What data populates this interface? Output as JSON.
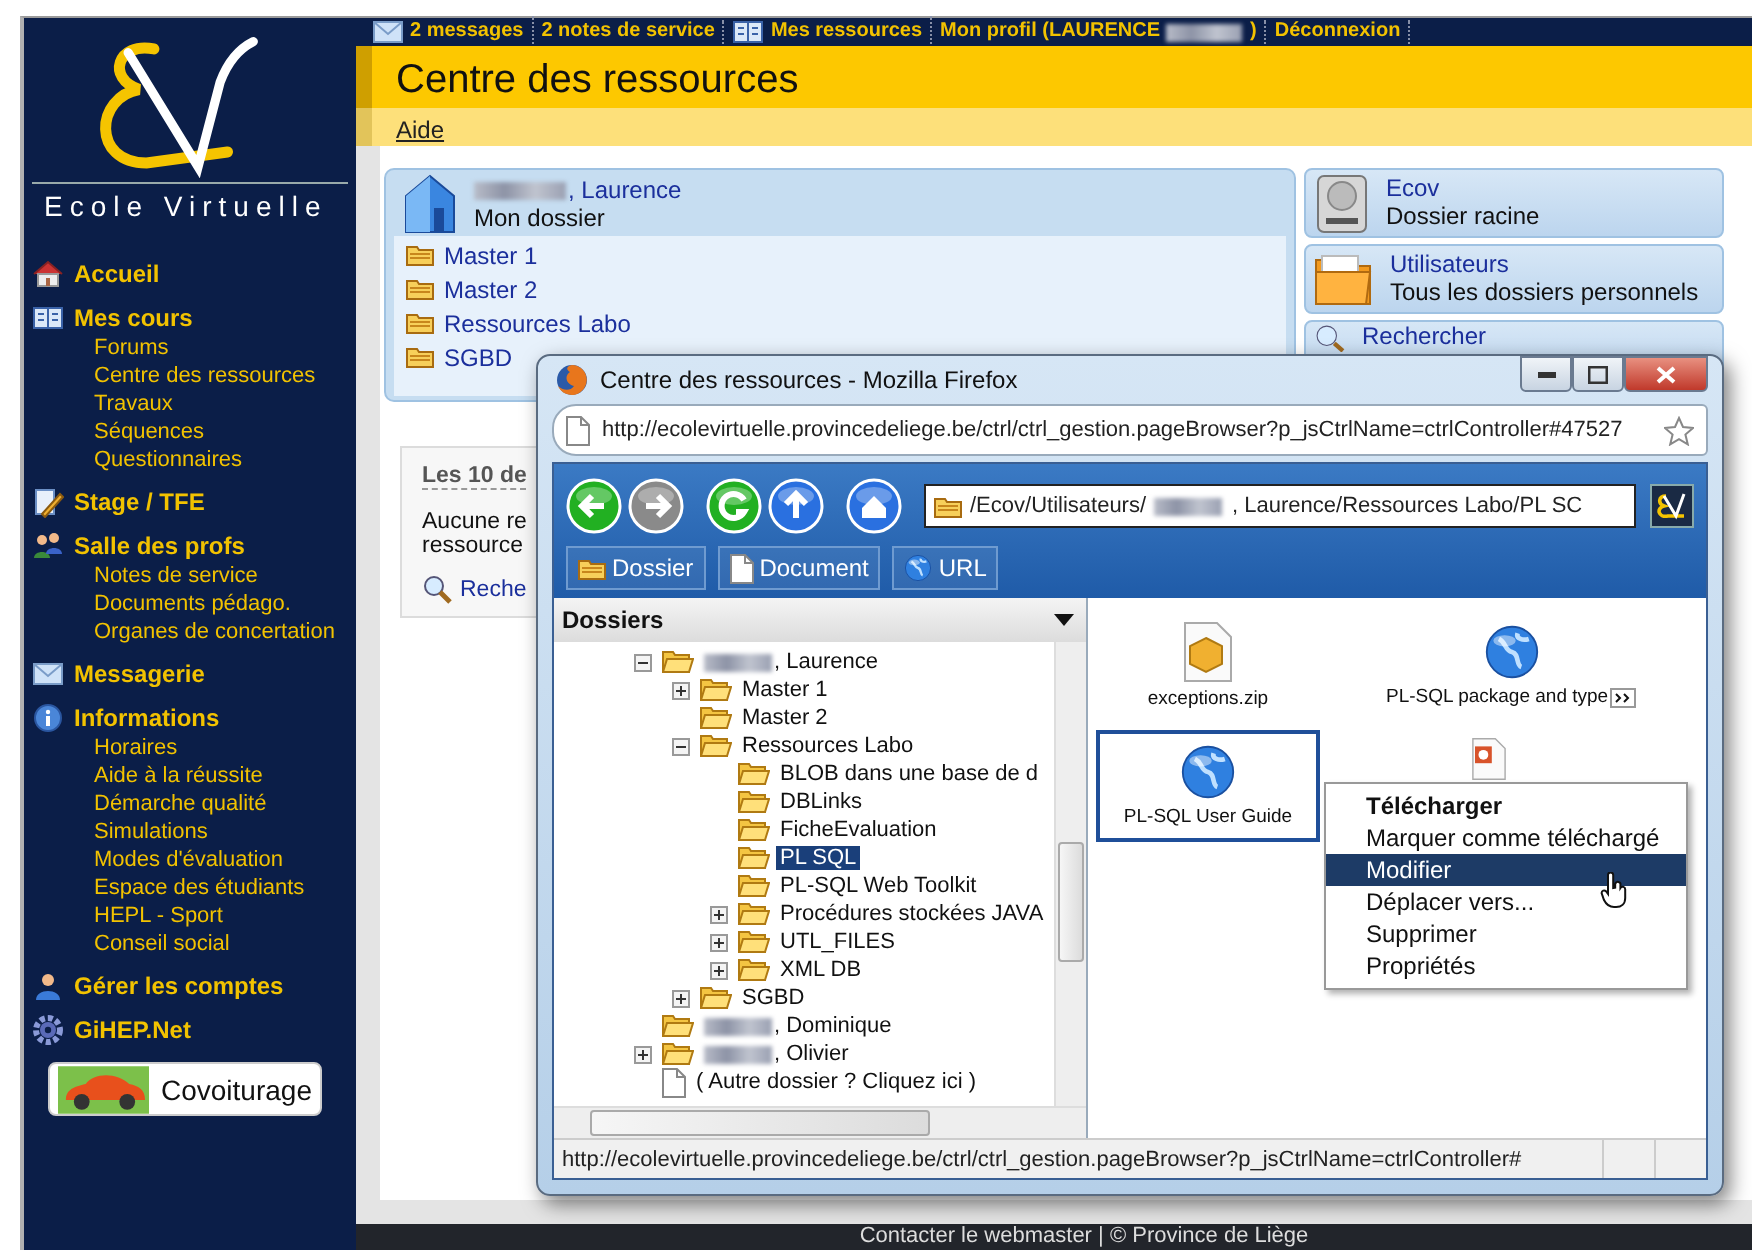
{
  "top_bar": {
    "links": [
      {
        "kind": "mail",
        "label": "2 messages"
      },
      {
        "label": "2 notes de service"
      },
      {
        "kind": "book",
        "label": "Mes ressources"
      },
      {
        "label": "Mon profil (LAURENCE",
        "redacted": true,
        "suffix": ")"
      },
      {
        "label": "Déconnexion"
      }
    ]
  },
  "sidebar": {
    "logo_text": "Ecole Virtuelle",
    "sections": [
      {
        "kind": "home",
        "label": "Accueil"
      },
      {
        "kind": "book",
        "label": "Mes cours",
        "items": [
          "Forums",
          "Centre des ressources",
          "Travaux",
          "Séquences",
          "Questionnaires"
        ]
      },
      {
        "kind": "pencil",
        "label": "Stage / TFE"
      },
      {
        "kind": "people",
        "label": "Salle des profs",
        "items": [
          "Notes de service",
          "Documents pédago.",
          "Organes de concertation"
        ]
      },
      {
        "kind": "mail",
        "label": "Messagerie"
      },
      {
        "kind": "info",
        "label": "Informations",
        "items": [
          "Horaires",
          "Aide à la réussite",
          "Démarche qualité",
          "Simulations",
          "Modes d'évaluation",
          "Espace des étudiants",
          "HEPL - Sport",
          "Conseil social"
        ]
      },
      {
        "kind": "user",
        "label": "Gérer les comptes"
      },
      {
        "kind": "gear",
        "label": "GiHEP.Net"
      }
    ],
    "carpool": "Covoiturage"
  },
  "header": {
    "title": "Centre des ressources",
    "help_link": "Aide"
  },
  "my_folder": {
    "owner": ", Laurence",
    "redacted": true,
    "subtitle": "Mon dossier",
    "folders": [
      "Master 1",
      "Master 2",
      "Ressources Labo",
      "SGBD"
    ]
  },
  "shortcuts": [
    {
      "kind": "disk",
      "title": "Ecov",
      "subtitle": "Dossier racine"
    },
    {
      "kind": "folder",
      "title": "Utilisateurs",
      "subtitle": "Tous les dossiers personnels"
    },
    {
      "kind": "search",
      "title": "Rechercher"
    }
  ],
  "recent": {
    "title": "Les 10 de",
    "lines": [
      "Aucune re",
      "ressource"
    ],
    "search_link": "Reche"
  },
  "popup": {
    "title": "Centre des ressources - Mozilla Firefox",
    "url": "http://ecolevirtuelle.provincedeliege.be/ctrl/ctrl_gestion.pageBrowser?p_jsCtrlName=ctrlController#47527",
    "nav_buttons": [
      {
        "kind": "back",
        "disabled": false
      },
      {
        "kind": "forward",
        "disabled": true
      },
      {
        "kind": "refresh",
        "disabled": false
      },
      {
        "kind": "up",
        "disabled": false
      },
      {
        "kind": "home",
        "disabled": false
      }
    ],
    "path": {
      "prefix": "/Ecov/Utilisateurs/",
      "redacted": true,
      "suffix": ", Laurence/Ressources Labo/PL SC"
    },
    "actions": [
      {
        "kind": "folder",
        "label": "Dossier"
      },
      {
        "kind": "document",
        "label": "Document"
      },
      {
        "kind": "globe",
        "label": "URL"
      }
    ],
    "tree_title": "Dossiers",
    "tree": [
      {
        "label": ", Laurence",
        "redacted": true,
        "expanded": true,
        "selected": false,
        "children": [
          {
            "label": "Master 1",
            "expanded": false,
            "selected": false
          },
          {
            "label": "Master 2",
            "selected": false
          },
          {
            "label": "Ressources Labo",
            "expanded": true,
            "selected": false,
            "children": [
              {
                "label": "BLOB dans une base de d",
                "selected": false
              },
              {
                "label": "DBLinks",
                "selected": false
              },
              {
                "label": "FicheEvaluation",
                "selected": false
              },
              {
                "label": "PL SQL",
                "selected": true
              },
              {
                "label": "PL-SQL Web Toolkit",
                "selected": false
              },
              {
                "label": "Procédures stockées JAVA",
                "expanded": false,
                "selected": false
              },
              {
                "label": "UTL_FILES",
                "expanded": false,
                "selected": false
              },
              {
                "label": "XML DB",
                "expanded": false,
                "selected": false
              }
            ]
          },
          {
            "label": "SGBD",
            "expanded": false,
            "selected": false
          }
        ]
      },
      {
        "label": ", Dominique",
        "redacted": true,
        "selected": false
      },
      {
        "label": ", Olivier",
        "redacted": true,
        "expanded": false,
        "selected": false
      },
      {
        "label": "( Autre dossier ? Cliquez ici )",
        "kind": "other",
        "selected": false
      }
    ],
    "files": [
      {
        "kind": "zip",
        "label": "exceptions.zip",
        "selected": false
      },
      {
        "kind": "web",
        "label": "PL-SQL package and type",
        "truncated": true,
        "selected": false
      },
      {
        "kind": "web",
        "label": "PL-SQL User Guide",
        "selected": true
      },
      {
        "kind": "slides",
        "selected": false
      }
    ],
    "context_menu": [
      {
        "label": "Télécharger",
        "default": true,
        "selected": false
      },
      {
        "label": "Marquer comme téléchargé",
        "default": false,
        "selected": false
      },
      {
        "label": "Modifier",
        "default": false,
        "selected": true
      },
      {
        "label": "Déplacer vers...",
        "default": false,
        "selected": false
      },
      {
        "label": "Supprimer",
        "default": false,
        "selected": false
      },
      {
        "label": "Propriétés",
        "default": false,
        "selected": false
      }
    ],
    "status": "http://ecolevirtuelle.provincedeliege.be/ctrl/ctrl_gestion.pageBrowser?p_jsCtrlName=ctrlController#"
  },
  "footer": "Contacter le webmaster | © Province de Liège"
}
